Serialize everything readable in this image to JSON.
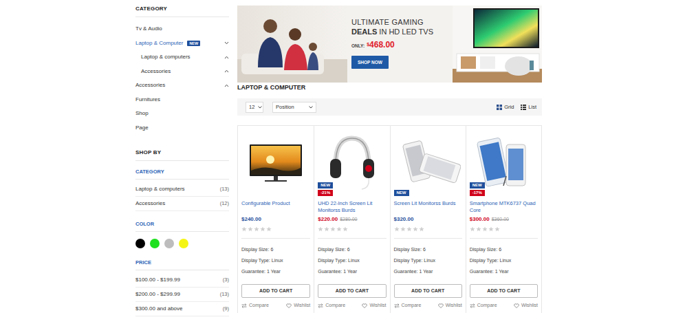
{
  "sidebar": {
    "heading": "CATEGORY",
    "categories": [
      {
        "label": "Tv & Audio",
        "kind": "top",
        "selected": false,
        "expandable": false,
        "expanded": false
      },
      {
        "label": "Laptop & Computer",
        "kind": "top",
        "selected": true,
        "expandable": true,
        "expanded": true,
        "badge": "NEW"
      },
      {
        "label": "Laptop & computers",
        "kind": "sub",
        "selected": false,
        "expandable": true,
        "expanded": false
      },
      {
        "label": "Accessories",
        "kind": "sub",
        "selected": false,
        "expandable": true,
        "expanded": false
      },
      {
        "label": "Accessories",
        "kind": "top",
        "selected": false,
        "expandable": true,
        "expanded": false
      },
      {
        "label": "Furnitures",
        "kind": "top",
        "selected": false,
        "expandable": false,
        "expanded": false
      },
      {
        "label": "Shop",
        "kind": "top",
        "selected": false,
        "expandable": false,
        "expanded": false
      },
      {
        "label": "Page",
        "kind": "top",
        "selected": false,
        "expandable": false,
        "expanded": false
      }
    ]
  },
  "shop_by": {
    "heading": "SHOP BY",
    "category": {
      "heading": "CATEGORY",
      "items": [
        {
          "label": "Laptop & computers",
          "count": "(13)"
        },
        {
          "label": "Accessories",
          "count": "(12)"
        }
      ]
    },
    "color": {
      "heading": "COLOR",
      "swatches": [
        {
          "color": "#000000"
        },
        {
          "color": "#1ee01e"
        },
        {
          "color": "#bdbdbd"
        },
        {
          "color": "#f5f514"
        }
      ]
    },
    "price": {
      "heading": "PRICE",
      "items": [
        {
          "label": "$100.00 - $199.99",
          "count": "(3)"
        },
        {
          "label": "$200.00 - $299.99",
          "count": "(13)"
        },
        {
          "label": "$300.00 and above",
          "count": "(9)"
        }
      ]
    }
  },
  "banner": {
    "title": "ULTIMATE GAMING",
    "deals": "DEALS",
    "subtitle": "IN HD LED TVS",
    "only": "ONLY:",
    "currency": "$",
    "price": "468.00",
    "button": "SHOP NOW"
  },
  "section_title": "LAPTOP & COMPUTER",
  "toolbar": {
    "limit": "12",
    "sort": "Position",
    "views": [
      "Grid",
      "List"
    ]
  },
  "products": [
    {
      "kind": "tv",
      "name": "Configurable Product",
      "price": "$240.00",
      "old_price": "",
      "on_sale": false,
      "badges": [],
      "stars": 0,
      "attributes": [
        "Display Size: 6",
        "Display Type: Linux",
        "Guarantee: 1 Year"
      ],
      "button": "ADD TO CART",
      "compare": "Compare",
      "wishlist": "Wishlist"
    },
    {
      "kind": "headphones",
      "name": "UHD 22-Inch Screen Lit Monitorss Burds",
      "price": "$220.00",
      "old_price": "$280.00",
      "on_sale": true,
      "badges": [
        {
          "label": "NEW",
          "color": "#1f4f9c"
        },
        {
          "label": "-21%",
          "color": "#d0021b"
        }
      ],
      "stars": 0,
      "attributes": [
        "Display Size: 6",
        "Display Type: Linux",
        "Guarantee: 1 Year"
      ],
      "button": "ADD TO CART",
      "compare": "Compare",
      "wishlist": "Wishlist"
    },
    {
      "kind": "phone",
      "name": "Screen Lit Monitorss Burds",
      "price": "$320.00",
      "old_price": "",
      "on_sale": false,
      "badges": [
        {
          "label": "NEW",
          "color": "#1f4f9c"
        }
      ],
      "stars": 0,
      "attributes": [
        "Display Size: 6",
        "Display Type: Linux",
        "Guarantee: 1 Year"
      ],
      "button": "ADD TO CART",
      "compare": "Compare",
      "wishlist": "Wishlist"
    },
    {
      "kind": "phablet",
      "name": "Smartphone MTK6737 Quad Core",
      "price": "$300.00",
      "old_price": "$360.00",
      "on_sale": true,
      "badges": [
        {
          "label": "NEW",
          "color": "#1f4f9c"
        },
        {
          "label": "-17%",
          "color": "#d0021b"
        }
      ],
      "stars": 0,
      "attributes": [
        "Display Size: 6",
        "Display Type: Linux",
        "Guarantee: 1 Year"
      ],
      "button": "ADD TO CART",
      "compare": "Compare",
      "wishlist": "Wishlist"
    }
  ]
}
